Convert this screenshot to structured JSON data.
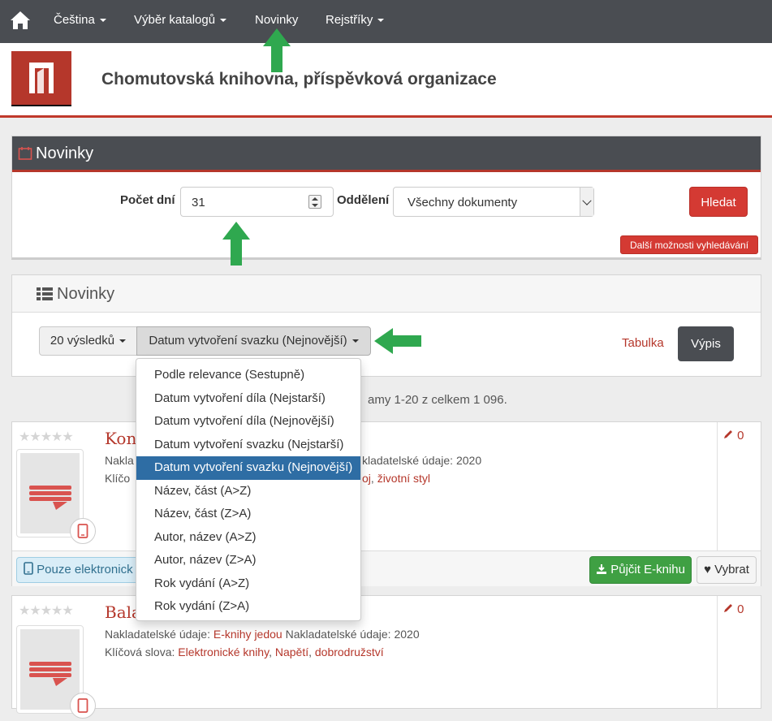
{
  "topnav": {
    "items": [
      {
        "label": "Čeština",
        "dropdown": true
      },
      {
        "label": "Výběr katalogů",
        "dropdown": true
      },
      {
        "label": "Novinky",
        "dropdown": false
      },
      {
        "label": "Rejstříky",
        "dropdown": true
      }
    ]
  },
  "header": {
    "title": "Chomutovská knihovna, příspěvková organizace"
  },
  "search_panel": {
    "title": "Novinky",
    "days_label": "Počet dní",
    "days_value": "31",
    "dept_label": "Oddělení",
    "dept_value": "Všechny dokumenty",
    "search_button": "Hledat",
    "more_options": "Další možnosti vyhledávání"
  },
  "results_panel": {
    "title": "Novinky",
    "results_per_page": "20 výsledků",
    "sort_selected": "Datum vytvoření svazku (Nejnovější)",
    "view_table": "Tabulka",
    "view_list": "Výpis"
  },
  "sort_options": [
    {
      "label": "Podle relevance (Sestupně)",
      "active": false
    },
    {
      "label": "Datum vytvoření díla (Nejstarší)",
      "active": false
    },
    {
      "label": "Datum vytvoření díla (Nejnovější)",
      "active": false
    },
    {
      "label": "Datum vytvoření svazku (Nejstarší)",
      "active": false
    },
    {
      "label": "Datum vytvoření svazku (Nejnovější)",
      "active": true
    },
    {
      "label": "Název, část (A>Z)",
      "active": false
    },
    {
      "label": "Název, část (Z>A)",
      "active": false
    },
    {
      "label": "Autor, název (A>Z)",
      "active": false
    },
    {
      "label": "Autor, název (Z>A)",
      "active": false
    },
    {
      "label": "Rok vydání (A>Z)",
      "active": false
    },
    {
      "label": "Rok vydání (Z>A)",
      "active": false
    }
  ],
  "summary": "amy 1-20 z celkem 1 096.",
  "records": [
    {
      "title_visible": "Kon",
      "publisher_label_visible": "Nakla",
      "publisher_suffix_visible": "kladatelské údaje: 2020",
      "keywords_label_visible": "Klíčo",
      "keywords_suffix_prefix": "oj",
      "keywords_suffix_link": "životní styl",
      "count": "0",
      "only_electronic": "Pouze elektronick",
      "borrow_button": "Půjčit E-knihu",
      "choose_button": "Vybrat"
    },
    {
      "title_visible": "Bala",
      "publisher_label": "Nakladatelské údaje:",
      "publisher_link": "E-knihy jedou",
      "publisher_year": "Nakladatelské údaje: 2020",
      "keywords_label": "Klíčová slova:",
      "keywords": [
        "Elektronické knihy",
        "Napětí",
        "dobrodružství"
      ],
      "count": "0"
    }
  ],
  "colors": {
    "accent": "#b5372b",
    "nav": "#4a4d52",
    "active": "#2e6da4",
    "green": "#3fa043",
    "arrow": "#2fa84f"
  }
}
